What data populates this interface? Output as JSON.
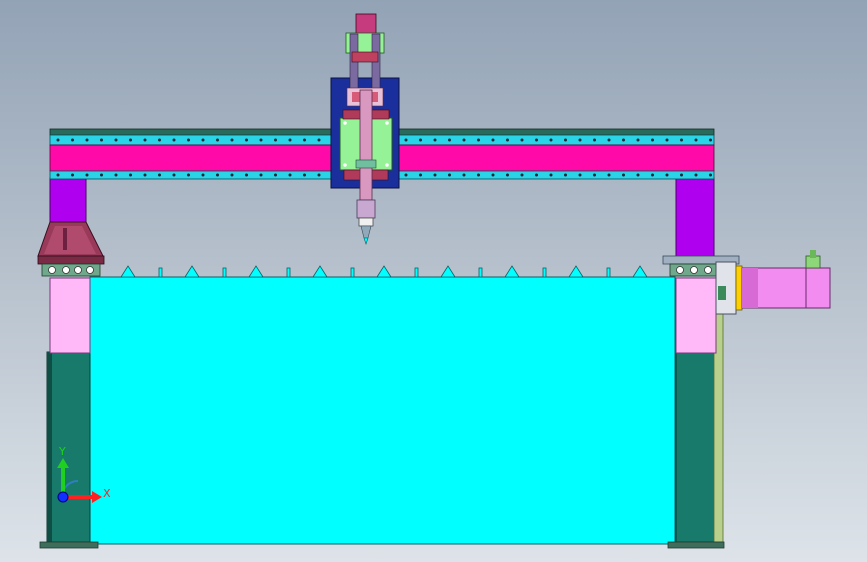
{
  "axes": {
    "x_label": "X",
    "y_label": "Y"
  },
  "colors": {
    "background_top": "#93a3b6",
    "background_bottom": "#dde3e9",
    "bed": "#00ffff",
    "beam_pink": "#ff0aa8",
    "beam_cyan": "#2ad4e6",
    "column_purple": "#b000f0",
    "leg_dark_teal": "#187a6a",
    "leg_light_pink": "#ffb8f8",
    "head_blue": "#1a2f9c",
    "head_green": "#96f296",
    "motor_pink": "#f28cf0",
    "axis_x": "#ff2020",
    "axis_y": "#20d020",
    "axis_z": "#1030ff"
  }
}
